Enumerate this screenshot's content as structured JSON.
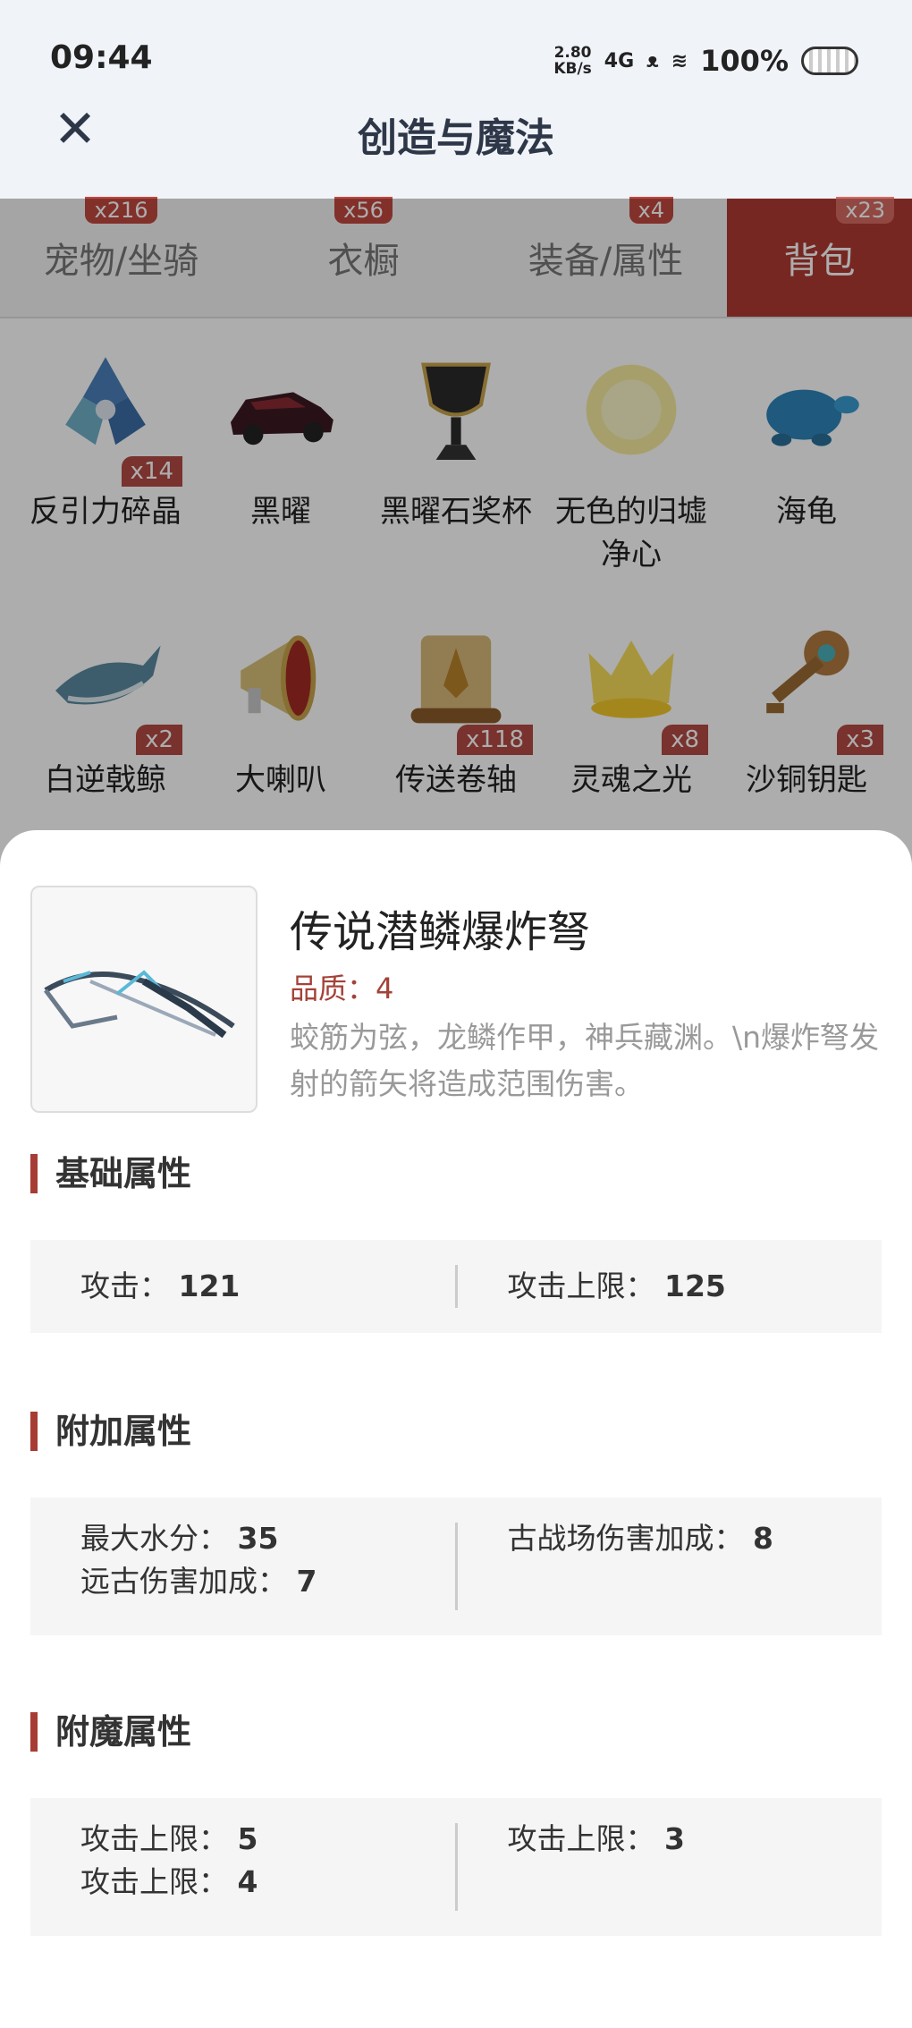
{
  "status": {
    "time": "09:44",
    "net_speed_value": "2.80",
    "net_speed_unit": "KB/s",
    "network": "4G",
    "battery": "100%"
  },
  "header": {
    "title": "创造与魔法"
  },
  "tabs": [
    {
      "label": "宠物/坐骑",
      "badge": "x216"
    },
    {
      "label": "衣橱",
      "badge": "x56"
    },
    {
      "label": "装备/属性",
      "badge": "x4"
    },
    {
      "label": "背包",
      "badge": "x23",
      "active": true
    }
  ],
  "grid": {
    "items": [
      {
        "name": "反引力碎晶",
        "count": "x14",
        "icon": "crystal-icon",
        "color": "#4a7fb8"
      },
      {
        "name": "黑曜",
        "count": "",
        "icon": "car-icon",
        "color": "#7a1a22"
      },
      {
        "name": "黑曜石奖杯",
        "count": "",
        "icon": "trophy-icon",
        "color": "#2a2a2a"
      },
      {
        "name": "无色的归墟净心",
        "count": "",
        "icon": "orb-icon",
        "color": "#f2e58a"
      },
      {
        "name": "海龟",
        "count": "",
        "icon": "turtle-icon",
        "color": "#2f84b8"
      },
      {
        "name": "白逆戟鲸",
        "count": "x2",
        "icon": "whale-icon",
        "color": "#6a9fb8"
      },
      {
        "name": "大喇叭",
        "count": "",
        "icon": "megaphone-icon",
        "color": "#c8b26a"
      },
      {
        "name": "传送卷轴",
        "count": "x118",
        "icon": "scroll-icon",
        "color": "#b8925a"
      },
      {
        "name": "灵魂之光",
        "count": "x8",
        "icon": "crown-icon",
        "color": "#f2d23a"
      },
      {
        "name": "沙铜钥匙",
        "count": "x3",
        "icon": "key-icon",
        "color": "#b07a40"
      }
    ]
  },
  "detail": {
    "name": "传说潜鳞爆炸弩",
    "quality": "品质：4",
    "description": "蛟筋为弦，龙鳞作甲，神兵藏渊。\\n爆炸弩发射的箭矢将造成范围伤害。",
    "icon": "crossbow-icon"
  },
  "sections": {
    "basic": {
      "title": "基础属性",
      "left": [
        {
          "label": "攻击：",
          "value": "121"
        }
      ],
      "right": [
        {
          "label": "攻击上限：",
          "value": "125"
        }
      ]
    },
    "extra": {
      "title": "附加属性",
      "left": [
        {
          "label": "最大水分：",
          "value": "35"
        },
        {
          "label": "远古伤害加成：",
          "value": "7"
        }
      ],
      "right": [
        {
          "label": "古战场伤害加成：",
          "value": "8"
        }
      ]
    },
    "enchant": {
      "title": "附魔属性",
      "left": [
        {
          "label": "攻击上限：",
          "value": "5"
        },
        {
          "label": "攻击上限：",
          "value": "4"
        }
      ],
      "right": [
        {
          "label": "攻击上限：",
          "value": "3"
        }
      ]
    }
  }
}
